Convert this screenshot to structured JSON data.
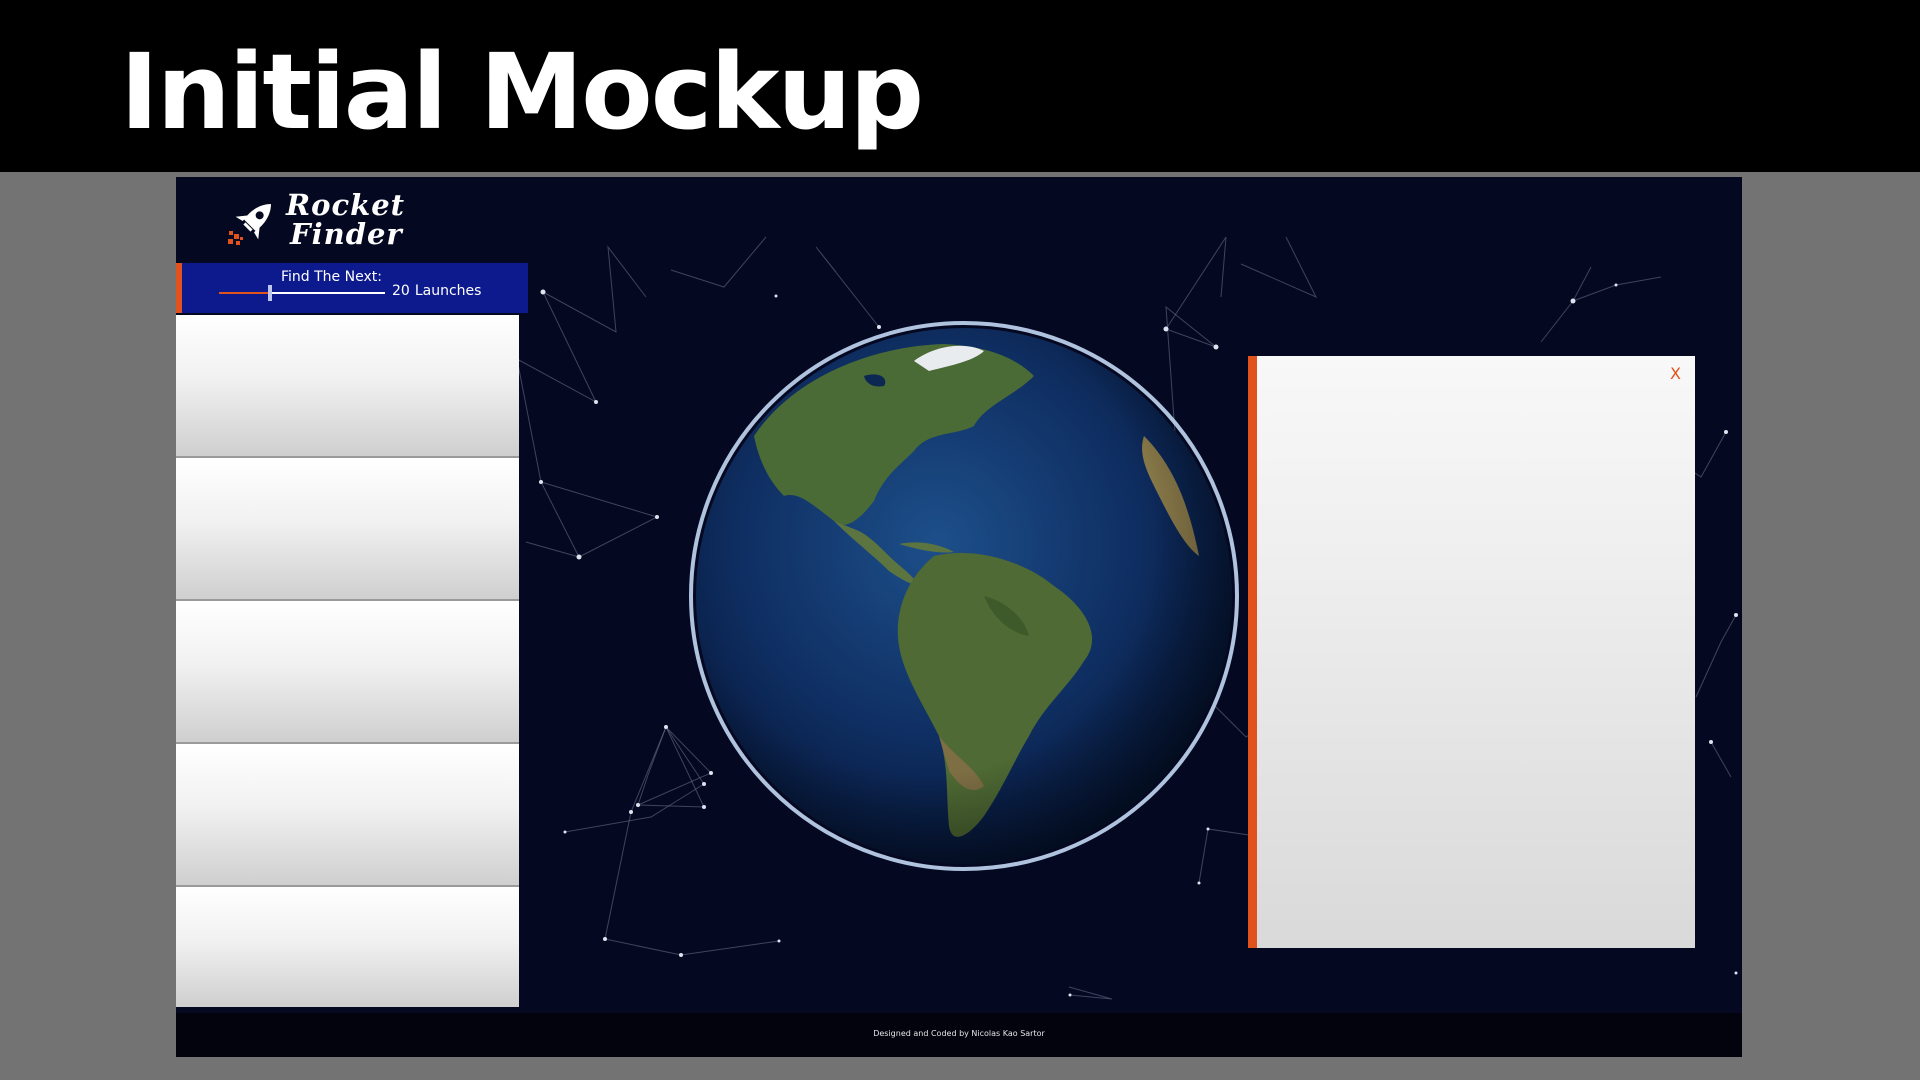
{
  "slide": {
    "title": "Initial Mockup"
  },
  "app": {
    "logo": {
      "line1": "Rocket",
      "line2": "Finder",
      "icon": "rocket-icon"
    },
    "launch_slider": {
      "heading": "Find The Next:",
      "count": "20",
      "unit": "Launches",
      "fill_fraction": 0.31
    },
    "launch_cards": [
      {},
      {},
      {},
      {},
      {}
    ],
    "details_panel": {
      "close_label": "X"
    },
    "footer": {
      "credit": "Designed and Coded by Nicolas Kao Sartor"
    }
  },
  "colors": {
    "accent": "#e2521c",
    "background": "#050821",
    "slider_bar": "#0d1a8e",
    "slide_frame": "#737373"
  }
}
